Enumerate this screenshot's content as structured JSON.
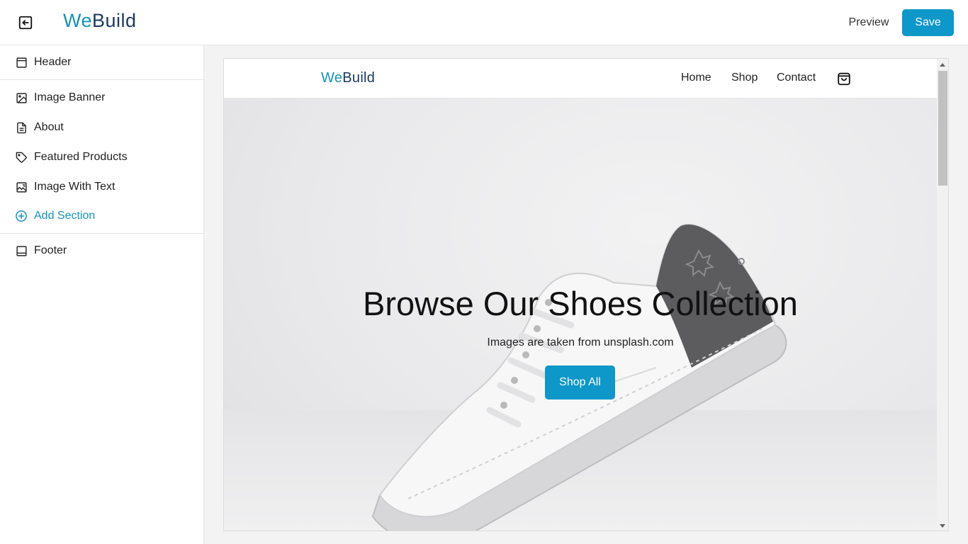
{
  "app": {
    "brand_part1": "We",
    "brand_part2": "Build",
    "preview_label": "Preview",
    "save_label": "Save",
    "accent_color": "#0e97c9"
  },
  "sidebar": {
    "items": [
      {
        "label": "Header",
        "icon": "header-layout-icon"
      },
      {
        "label": "Image Banner",
        "icon": "image-icon"
      },
      {
        "label": "About",
        "icon": "document-icon"
      },
      {
        "label": "Featured Products",
        "icon": "tag-icon"
      },
      {
        "label": "Image With Text",
        "icon": "image-text-icon"
      },
      {
        "label": "Add Section",
        "icon": "plus-circle-icon"
      },
      {
        "label": "Footer",
        "icon": "footer-layout-icon"
      }
    ]
  },
  "preview": {
    "brand_part1": "We",
    "brand_part2": "Build",
    "nav": [
      "Home",
      "Shop",
      "Contact"
    ],
    "banner": {
      "title": "Browse Our Shoes Collection",
      "subtitle": "Images are taken from unsplash.com",
      "button_label": "Shop All"
    }
  }
}
